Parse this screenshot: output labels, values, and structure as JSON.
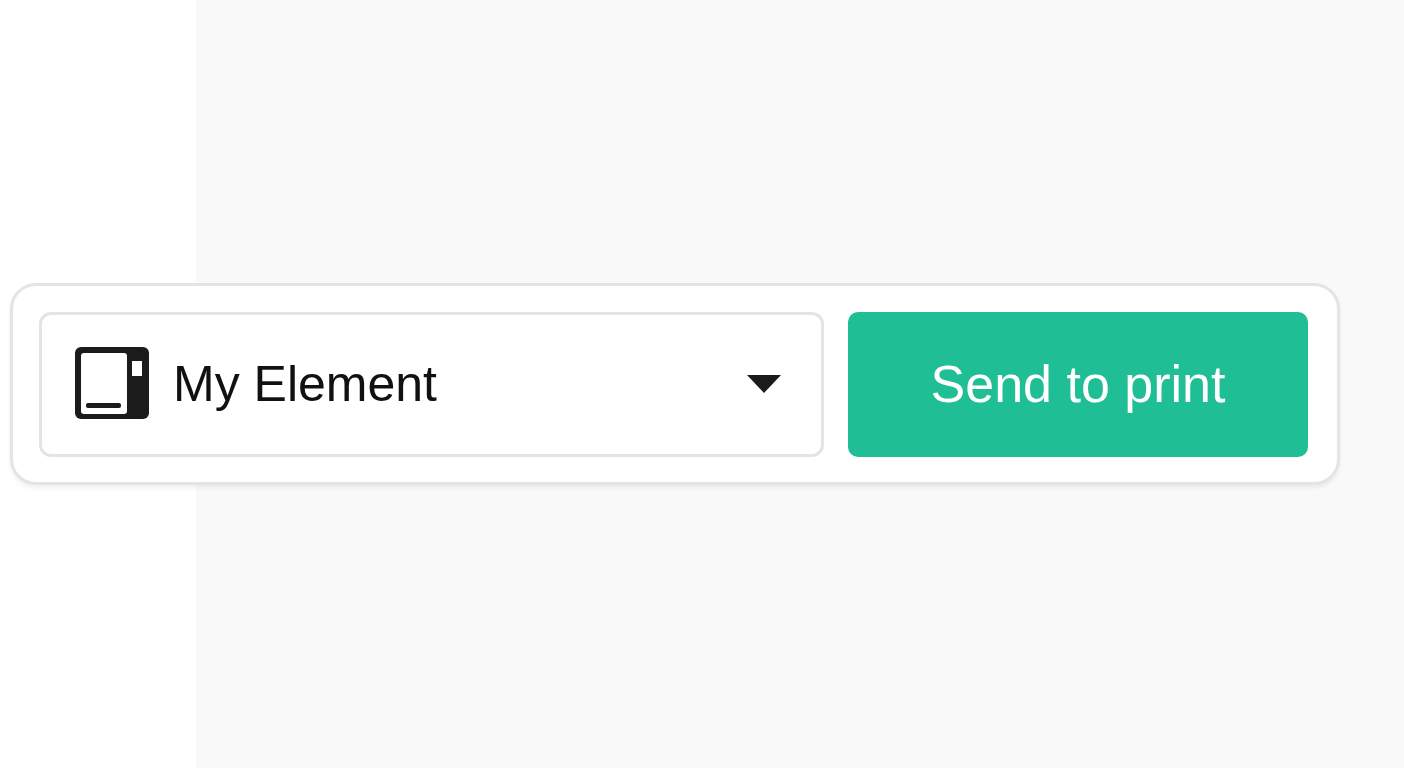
{
  "element_select": {
    "value": "My Element"
  },
  "buttons": [
    {
      "label": "Send to print"
    }
  ]
}
